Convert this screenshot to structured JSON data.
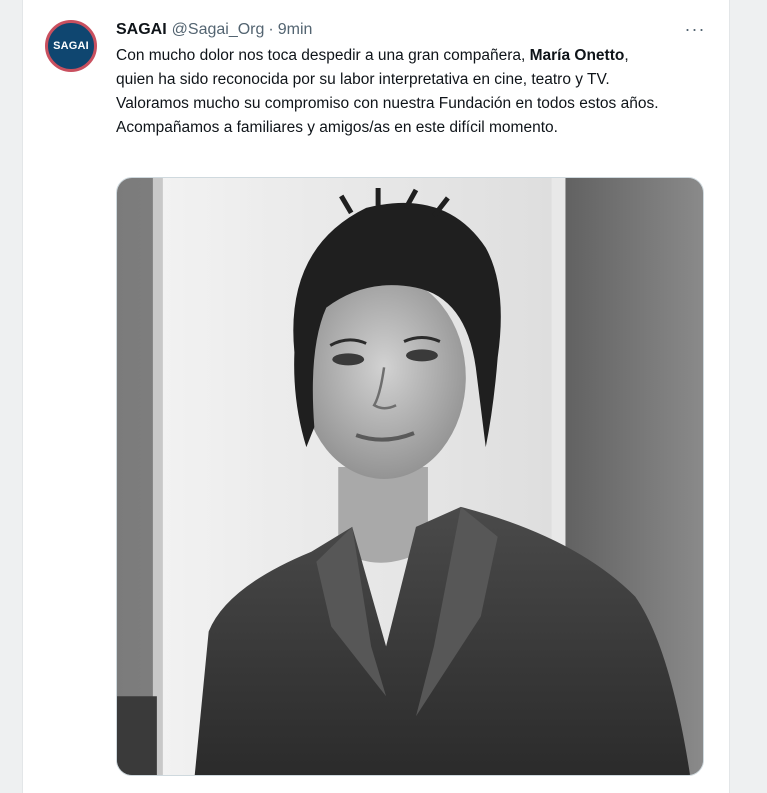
{
  "tweet": {
    "avatar_text": "SAGAI",
    "display_name": "SAGAI",
    "handle": "@Sagai_Org",
    "separator": "·",
    "time": "9min",
    "more_label": "···",
    "text": {
      "line1_prefix": "Con mucho dolor nos toca despedir a una gran compañera, ",
      "line1_bold": "María Onetto",
      "line1_suffix": ",",
      "line2": "quien ha sido reconocida por su labor interpretativa en cine, teatro y TV.",
      "line3": "Valoramos mucho su compromiso con nuestra Fundación en todos estos años.",
      "line4": "Acompañamos a familiares y amigos/as en este difícil momento."
    }
  },
  "colors": {
    "avatar_bg": "#0f4670",
    "avatar_ring": "#c9505f",
    "text_primary": "#0f1419",
    "text_secondary": "#536471"
  }
}
